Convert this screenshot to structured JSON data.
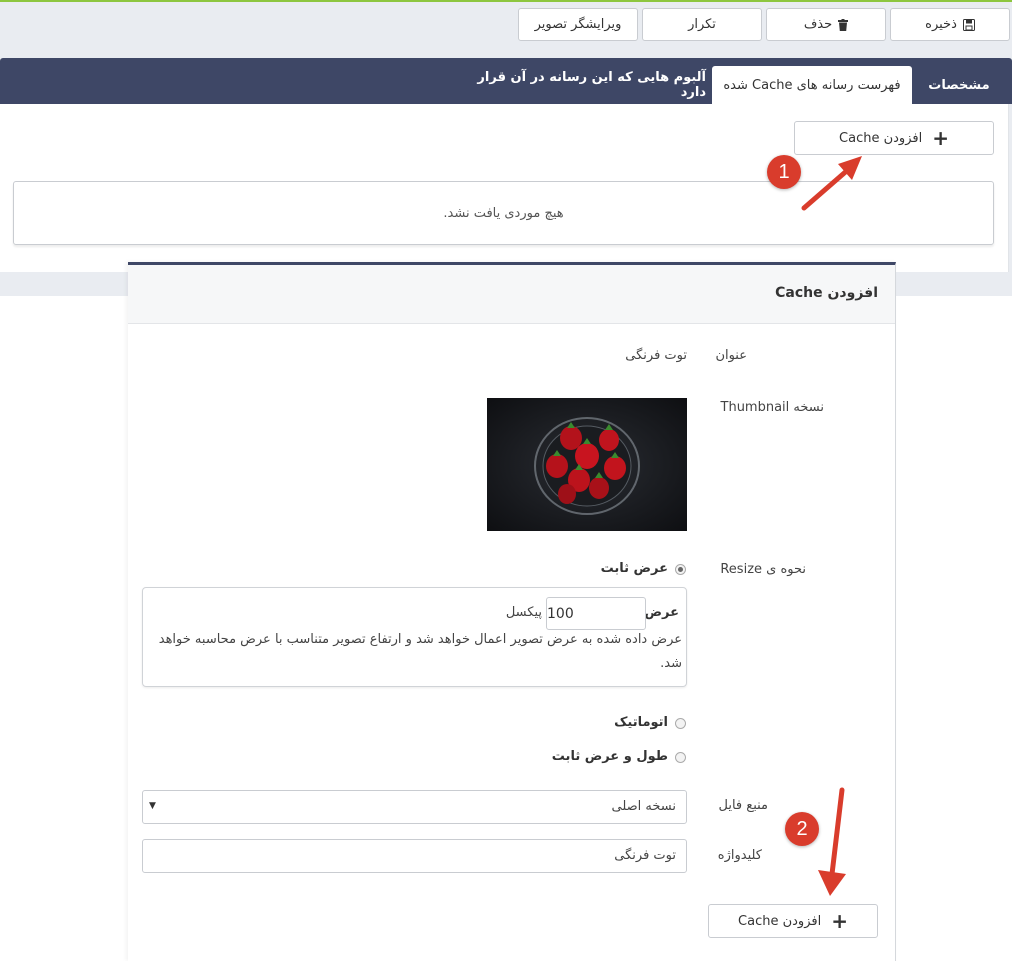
{
  "toolbar": {
    "save_label": "ذخیره",
    "delete_label": "حذف",
    "duplicate_label": "تکرار",
    "image_editor_label": "ویرایشگر تصویر"
  },
  "tabs": {
    "properties": "مشخصات",
    "cache_list": "فهرست رسانه های Cache شده",
    "albums": "آلبوم هایی که این رسانه در آن قرار دارد"
  },
  "cache_panel": {
    "add_cache_label": "افزودن Cache",
    "empty_message": "هیچ موردی یافت نشد."
  },
  "annotations": {
    "badge_1": "1",
    "badge_2": "2",
    "annotation_color": "#d93c2c"
  },
  "modal": {
    "title": "افزودن Cache",
    "title_label": "عنوان",
    "title_value": "توت فرنگی",
    "thumbnail_label": "نسخه Thumbnail",
    "resize_label": "نحوه ی Resize",
    "resize_options": {
      "fixed_width": "عرض ثابت",
      "auto": "اتوماتیک",
      "fixed_width_height": "طول و عرض ثابت"
    },
    "width_label": "عرض",
    "width_value": "100",
    "pixel_unit": "پیکسل",
    "help_text": "عرض داده شده به عرض تصویر اعمال خواهد شد و ارتفاع تصویر متناسب با عرض محاسبه خواهد شد.",
    "file_source_label": "منبع فایل",
    "file_source_value": "نسخه اصلی",
    "keyword_label": "کلیدواژه",
    "keyword_value": "توت فرنگی",
    "submit_label": "افزودن Cache"
  },
  "colors": {
    "accent_green": "#8dc63f",
    "header_navy": "#3e4766"
  }
}
